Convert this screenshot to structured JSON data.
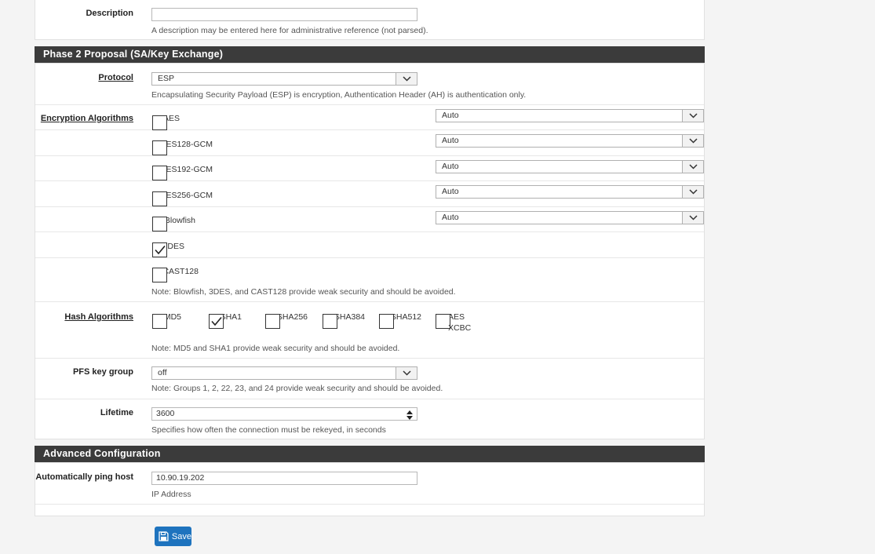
{
  "description": {
    "label": "Description",
    "value": "",
    "help": "A description may be entered here for administrative reference (not parsed)."
  },
  "phase2": {
    "header": "Phase 2 Proposal (SA/Key Exchange)",
    "protocol": {
      "label": "Protocol",
      "value": "ESP",
      "help": "Encapsulating Security Payload (ESP) is encryption, Authentication Header (AH) is authentication only."
    },
    "encryption": {
      "label": "Encryption Algorithms",
      "items": [
        {
          "name": "AES",
          "checked": false,
          "key_length": "Auto"
        },
        {
          "name": "AES128-GCM",
          "checked": false,
          "key_length": "Auto"
        },
        {
          "name": "AES192-GCM",
          "checked": false,
          "key_length": "Auto"
        },
        {
          "name": "AES256-GCM",
          "checked": false,
          "key_length": "Auto"
        },
        {
          "name": "Blowfish",
          "checked": false,
          "key_length": "Auto"
        },
        {
          "name": "3DES",
          "checked": true
        },
        {
          "name": "CAST128",
          "checked": false
        }
      ],
      "note": "Note: Blowfish, 3DES, and CAST128 provide weak security and should be avoided."
    },
    "hash": {
      "label": "Hash Algorithms",
      "items": [
        {
          "name": "MD5",
          "checked": false
        },
        {
          "name": "SHA1",
          "checked": true
        },
        {
          "name": "SHA256",
          "checked": false
        },
        {
          "name": "SHA384",
          "checked": false
        },
        {
          "name": "SHA512",
          "checked": false
        },
        {
          "name": "AES-XCBC",
          "line1": "AES-",
          "line2": "XCBC",
          "checked": false
        }
      ],
      "note": "Note: MD5 and SHA1 provide weak security and should be avoided."
    },
    "pfs": {
      "label": "PFS key group",
      "value": "off",
      "note": "Note: Groups 1, 2, 22, 23, and 24 provide weak security and should be avoided."
    },
    "lifetime": {
      "label": "Lifetime",
      "value": "3600",
      "help": "Specifies how often the connection must be rekeyed, in seconds"
    }
  },
  "advanced": {
    "header": "Advanced Configuration",
    "ping": {
      "label": "Automatically ping host",
      "value": "10.90.19.202",
      "help": "IP Address"
    }
  },
  "save_label": "Save",
  "icons": {
    "dropdown": "chevron-down-icon",
    "checkbox_check": "check-icon",
    "save": "floppy-disk-icon",
    "spinner": "spinner-arrows-icon"
  }
}
